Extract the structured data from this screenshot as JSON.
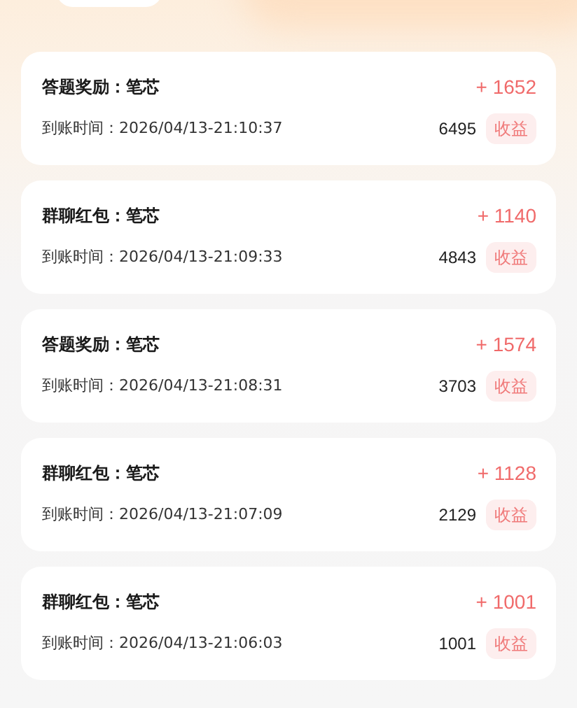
{
  "records": [
    {
      "title": "答题奖励：笔芯",
      "amount": "+ 1652",
      "time": "到账时间：2026/04/13-21:10:37",
      "balance": "6495",
      "tag": "收益"
    },
    {
      "title": "群聊红包：笔芯",
      "amount": "+ 1140",
      "time": "到账时间：2026/04/13-21:09:33",
      "balance": "4843",
      "tag": "收益"
    },
    {
      "title": "答题奖励：笔芯",
      "amount": "+ 1574",
      "time": "到账时间：2026/04/13-21:08:31",
      "balance": "3703",
      "tag": "收益"
    },
    {
      "title": "群聊红包：笔芯",
      "amount": "+ 1128",
      "time": "到账时间：2026/04/13-21:07:09",
      "balance": "2129",
      "tag": "收益"
    },
    {
      "title": "群聊红包：笔芯",
      "amount": "+ 1001",
      "time": "到账时间：2026/04/13-21:06:03",
      "balance": "1001",
      "tag": "收益"
    }
  ]
}
